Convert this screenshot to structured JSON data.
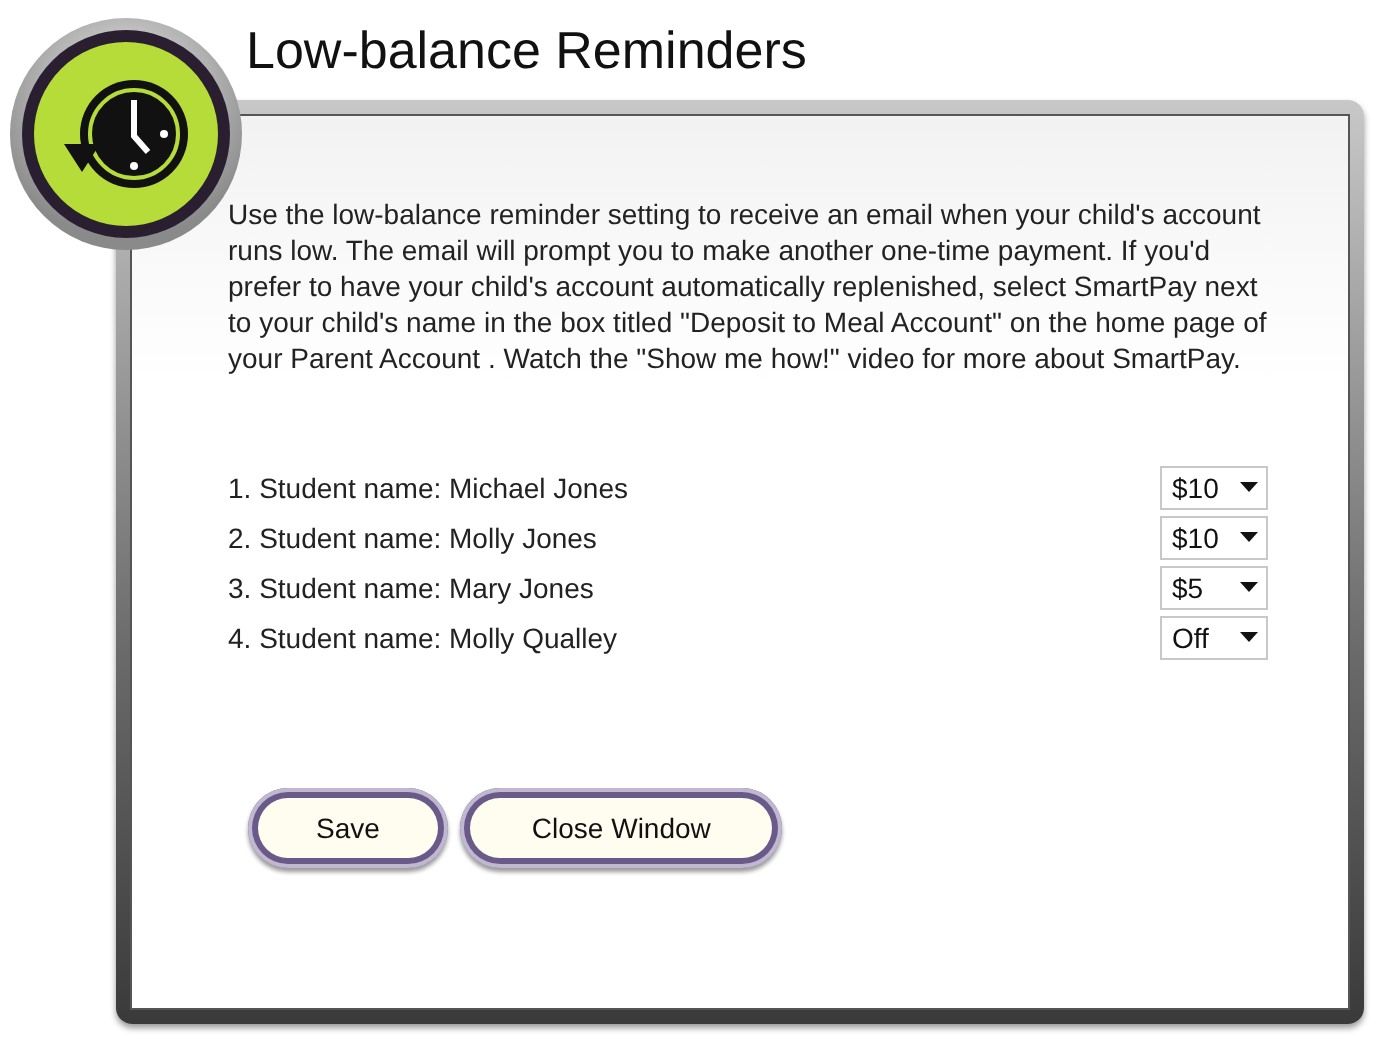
{
  "window": {
    "title": "Low-balance Reminders"
  },
  "intro": "Use the low-balance reminder setting to receive an email when your child's account runs low. The email will prompt you to make another one-time payment. If you'd prefer to have your child's account automatically replenished, select SmartPay next to your child's name in the box titled \"Deposit to Meal Account\" on the home page of your Parent Account . Watch the \"Show me how!\" video for more about SmartPay.",
  "students": [
    {
      "label": "1. Student name: Michael Jones",
      "amount": "$10"
    },
    {
      "label": "2. Student name: Molly Jones",
      "amount": "$10"
    },
    {
      "label": "3. Student name: Mary Jones",
      "amount": "$5"
    },
    {
      "label": "4. Student name: Molly Qualley",
      "amount": "Off"
    }
  ],
  "buttons": [
    "Save",
    "Close Window"
  ]
}
